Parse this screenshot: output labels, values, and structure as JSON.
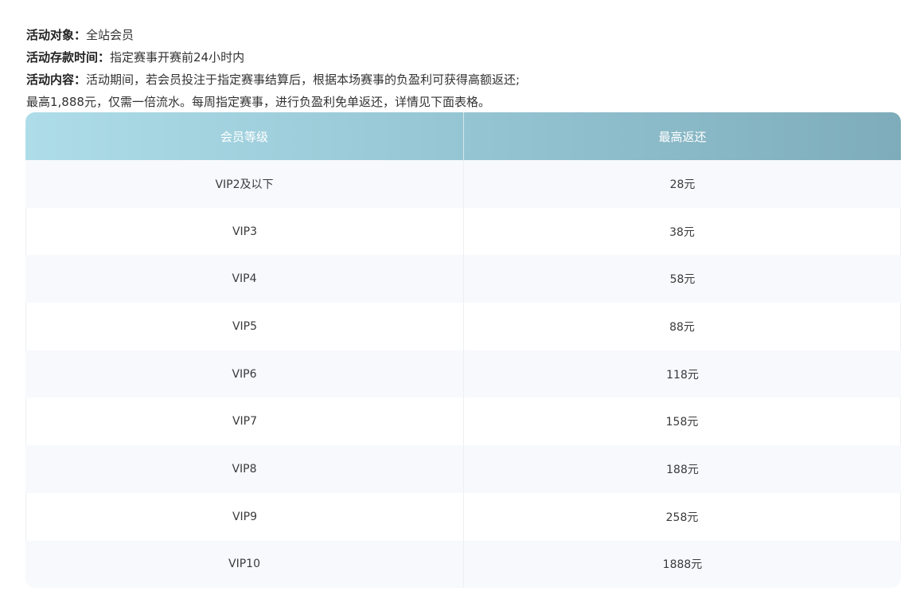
{
  "intro": {
    "target_label": "活动对象：",
    "target_value": "全站会员",
    "deposit_label": "活动存款时间：",
    "deposit_value": "指定赛事开赛前24小时内",
    "content_label": "活动内容：",
    "content_value": "活动期间，若会员投注于指定赛事结算后，根据本场赛事的负盈利可获得高额返还;",
    "note": "最高1,888元，仅需一倍流水。每周指定赛事，进行负盈利免单返还，详情见下面表格。"
  },
  "table": {
    "headers": [
      "会员等级",
      "最高返还"
    ],
    "rows": [
      [
        "VIP2及以下",
        "28元"
      ],
      [
        "VIP3",
        "38元"
      ],
      [
        "VIP4",
        "58元"
      ],
      [
        "VIP5",
        "88元"
      ],
      [
        "VIP6",
        "118元"
      ],
      [
        "VIP7",
        "158元"
      ],
      [
        "VIP8",
        "188元"
      ],
      [
        "VIP9",
        "258元"
      ],
      [
        "VIP10",
        "1888元"
      ]
    ]
  },
  "colors": {
    "header_start": "#aedde9",
    "header_end": "#7eacba",
    "row_alt": "#f7f9fd",
    "text": "#333333"
  }
}
